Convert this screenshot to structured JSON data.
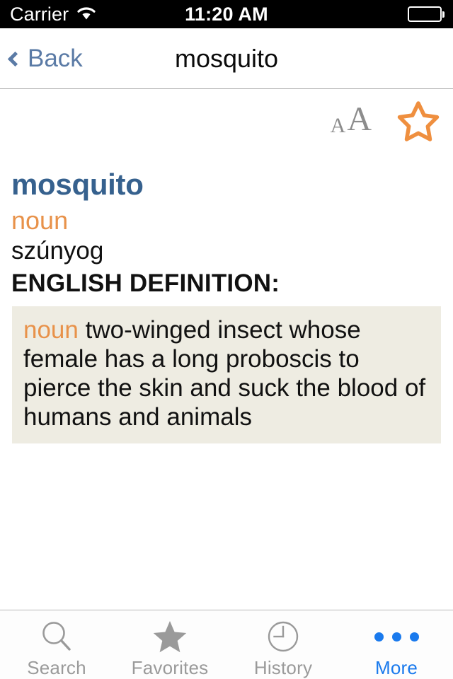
{
  "status_bar": {
    "carrier": "Carrier",
    "wifi_icon": "wifi-icon",
    "time": "11:20 AM",
    "battery_icon": "battery-full-icon"
  },
  "nav_bar": {
    "back_label": "Back",
    "back_icon": "chevron-left-icon",
    "title": "mosquito"
  },
  "toolbar": {
    "font_size_small": "A",
    "font_size_large": "A",
    "font_size_icon": "text-size-icon",
    "favorite_icon": "star-outline-icon",
    "favorite_color": "#ef8f3f"
  },
  "entry": {
    "headword": "mosquito",
    "headword_color": "#36618e",
    "part_of_speech": "noun",
    "pos_color": "#e8924a",
    "translation": "szúnyog",
    "section_title": "ENGLISH DEFINITION:",
    "definition": {
      "part_of_speech": "noun",
      "text": "two-winged insect whose female has a long proboscis to pierce the skin and suck the blood of humans and animals",
      "background": "#eeece2"
    }
  },
  "tab_bar": {
    "active_color": "#1a7aed",
    "inactive_color": "#9a9a9a",
    "items": [
      {
        "label": "Search",
        "icon": "magnifier-icon",
        "active": false
      },
      {
        "label": "Favorites",
        "icon": "star-filled-icon",
        "active": false
      },
      {
        "label": "History",
        "icon": "clock-icon",
        "active": false
      },
      {
        "label": "More",
        "icon": "ellipsis-icon",
        "active": true
      }
    ]
  }
}
